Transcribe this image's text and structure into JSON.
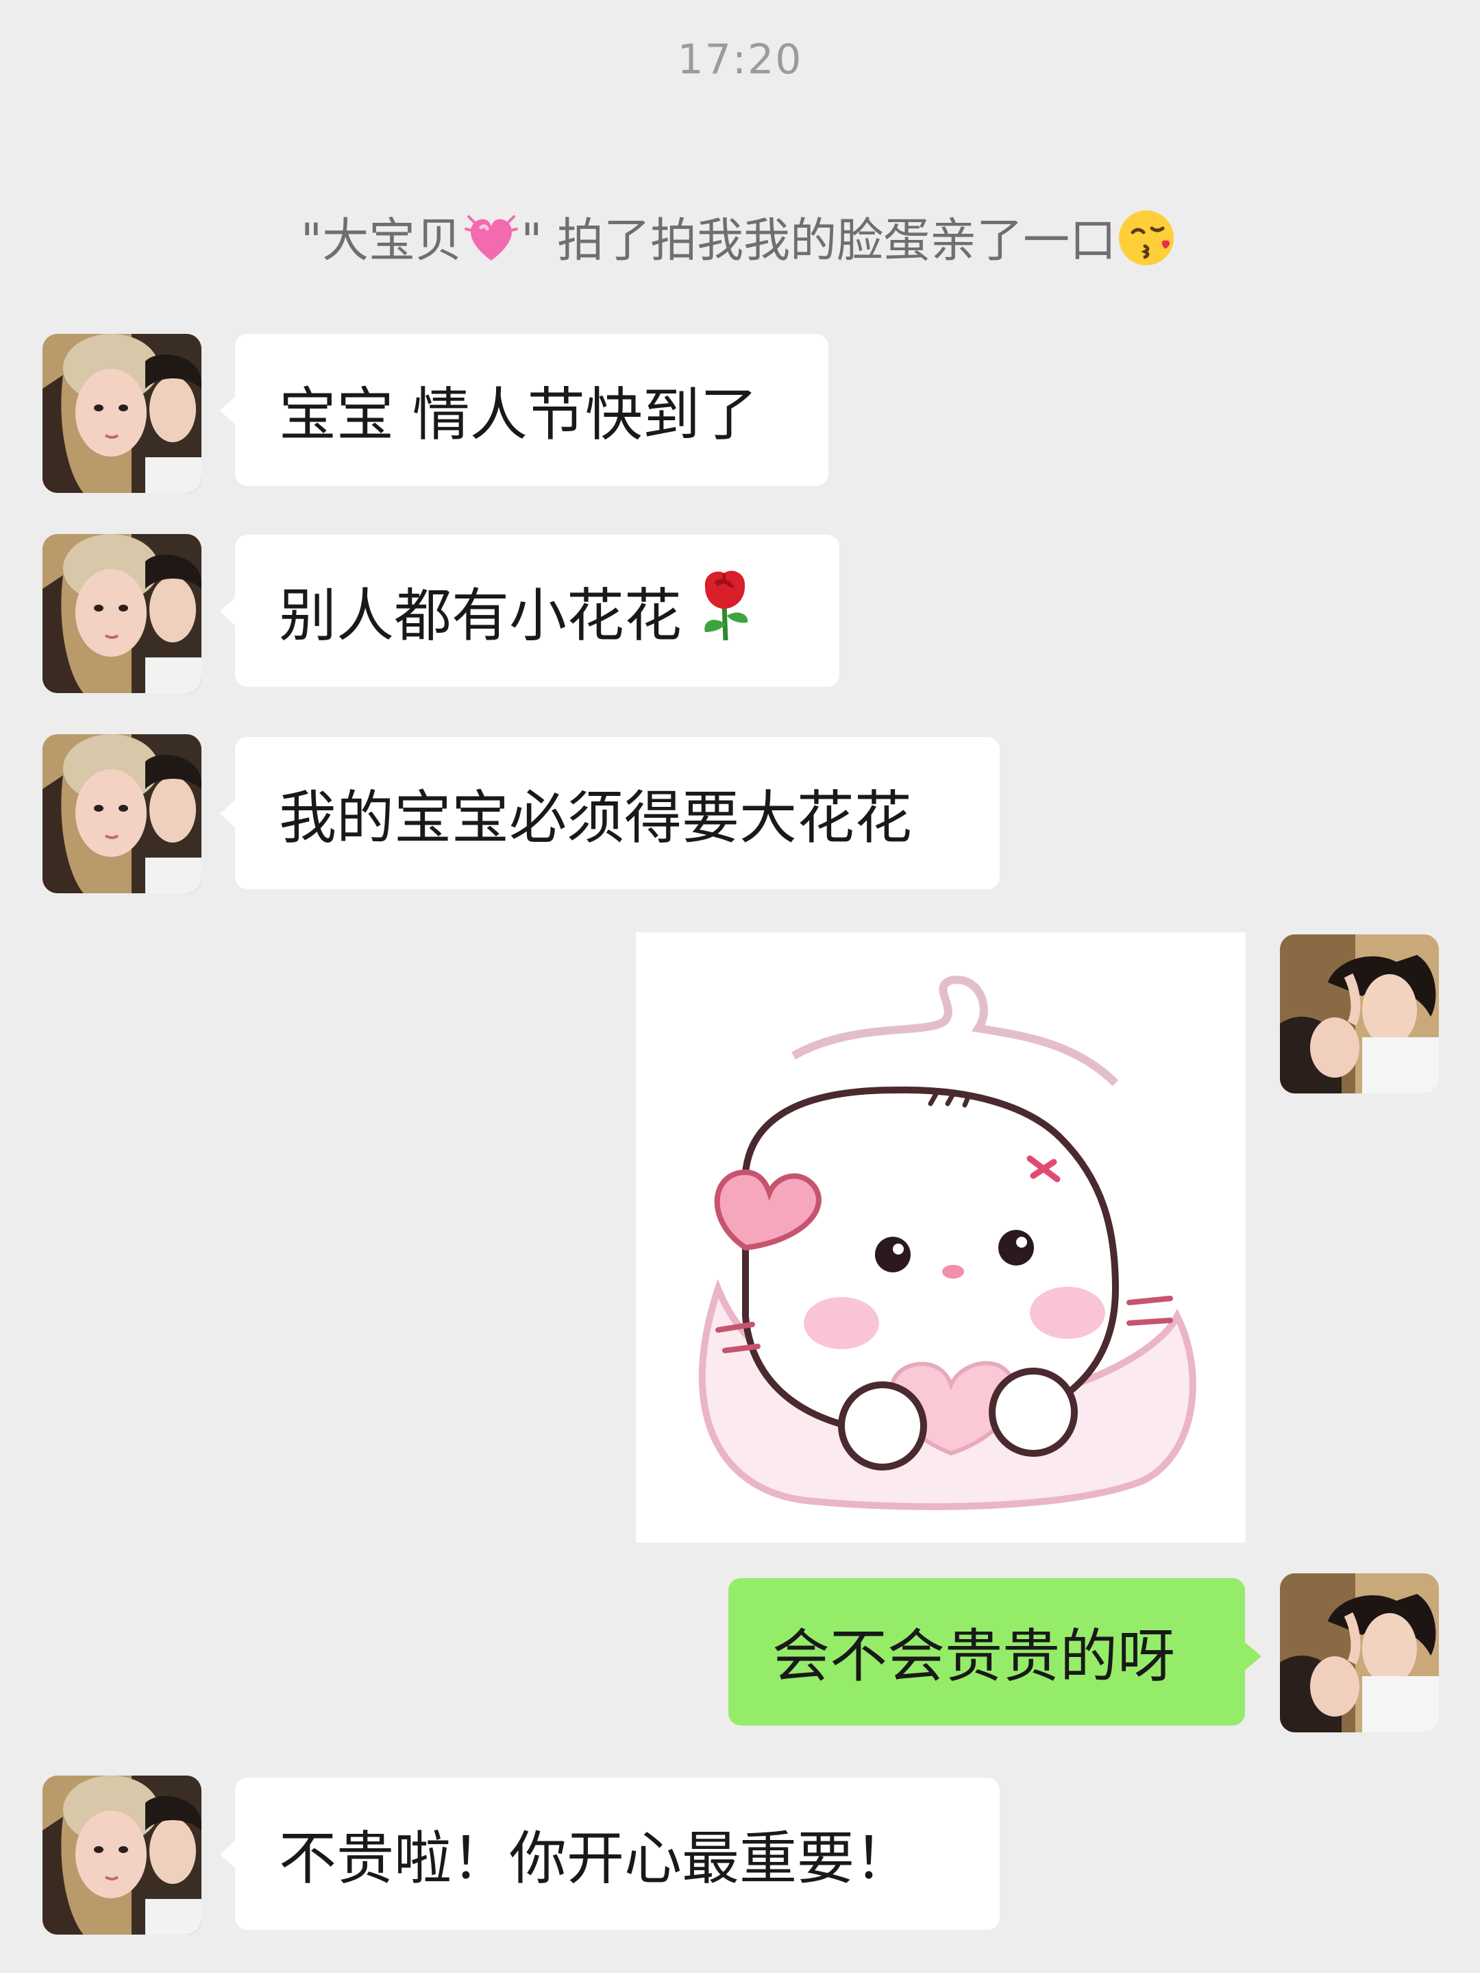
{
  "chat": {
    "timestamp": "17:20",
    "system_notice": {
      "prefix": "\"大宝贝",
      "suffix": "\" 拍了拍我我的脸蛋亲了一口",
      "heart_emoji": "growing-heart-icon",
      "kiss_emoji": "face-blowing-kiss-icon"
    },
    "messages": [
      {
        "side": "left",
        "text": "宝宝 情人节快到了"
      },
      {
        "side": "left",
        "text": "别人都有小花花",
        "emoji": "rose-icon"
      },
      {
        "side": "left",
        "text": "我的宝宝必须得要大花花"
      },
      {
        "side": "right",
        "type": "sticker",
        "sticker": "pink-cat-heart-sticker"
      },
      {
        "side": "right",
        "text": "会不会贵贵的呀"
      },
      {
        "side": "left",
        "text": "不贵啦！你开心最重要！"
      }
    ]
  },
  "colors": {
    "background": "#ededed",
    "incoming_bubble": "#ffffff",
    "outgoing_bubble": "#95ec69",
    "text": "#191919",
    "meta_text": "#9b9b9b"
  }
}
